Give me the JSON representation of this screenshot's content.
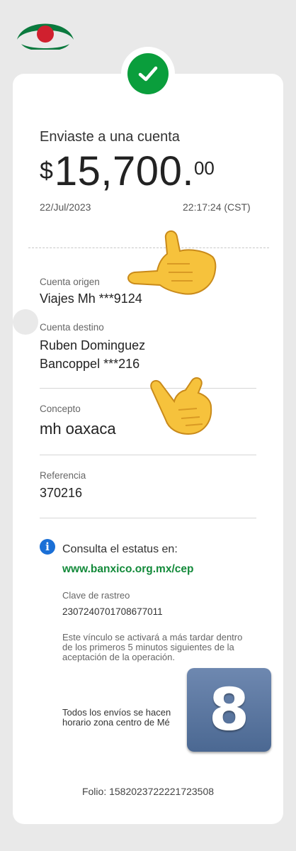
{
  "header": {
    "logo_icon": "bank-logo-icon"
  },
  "status": {
    "icon": "check-icon",
    "color": "#0a9e3c"
  },
  "transfer": {
    "title": "Enviaste a una cuenta",
    "currency": "$",
    "amount_int": "15,700.",
    "amount_dec": "00",
    "date": "22/Jul/2023",
    "time": "22:17:24 (CST)"
  },
  "origin": {
    "label": "Cuenta origen",
    "value": "Viajes Mh ***9124"
  },
  "destination": {
    "label": "Cuenta destino",
    "name": "Ruben Dominguez",
    "bank": "Bancoppel ***216"
  },
  "concept": {
    "label": "Concepto",
    "value": "mh oaxaca"
  },
  "reference": {
    "label": "Referencia",
    "value": "370216"
  },
  "info": {
    "icon": "info-icon",
    "consulta": "Consulta el estatus en:",
    "link": "www.banxico.org.mx/cep",
    "clave_label": "Clave de rastreo",
    "clave_value": "2307240701708677011",
    "note": "Este vínculo se activará a más tardar dentro de los primeros 5 minutos siguientes de la aceptación de la operación.",
    "note2_line1": "Todos los envíos se hacen",
    "note2_line2": "horario zona centro de Mé"
  },
  "folio": "Folio: 1582023722221723508",
  "overlay": {
    "tile_text": "8",
    "tile_color": "#5a77a1",
    "hand_icon": "pointing-hand-icon"
  }
}
